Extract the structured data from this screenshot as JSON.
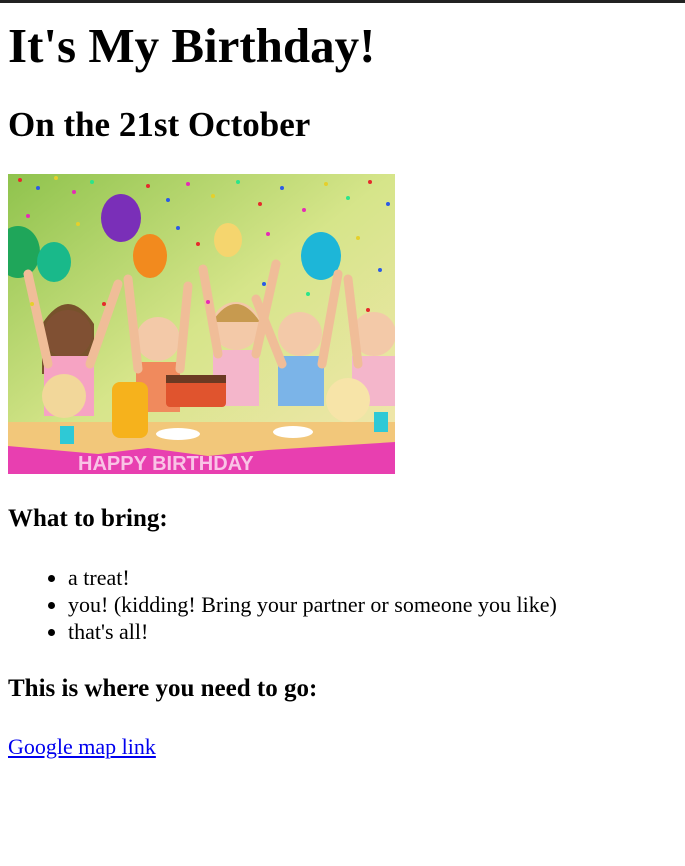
{
  "page": {
    "heading": "It's My Birthday!",
    "subheading": "On the 21st October",
    "image": {
      "banner_text": "HAPPY BIRTHDAY",
      "colors": {
        "table": "#f2c77a",
        "banner": "#e83fb0",
        "background": "#b9d86a"
      }
    },
    "bring_heading": "What to bring:",
    "bring_items": [
      "a treat!",
      "you! (kidding! Bring your partner or someone you like)",
      "that's all!"
    ],
    "go_heading": "This is where you need to go:",
    "map_link": "Google map link"
  }
}
